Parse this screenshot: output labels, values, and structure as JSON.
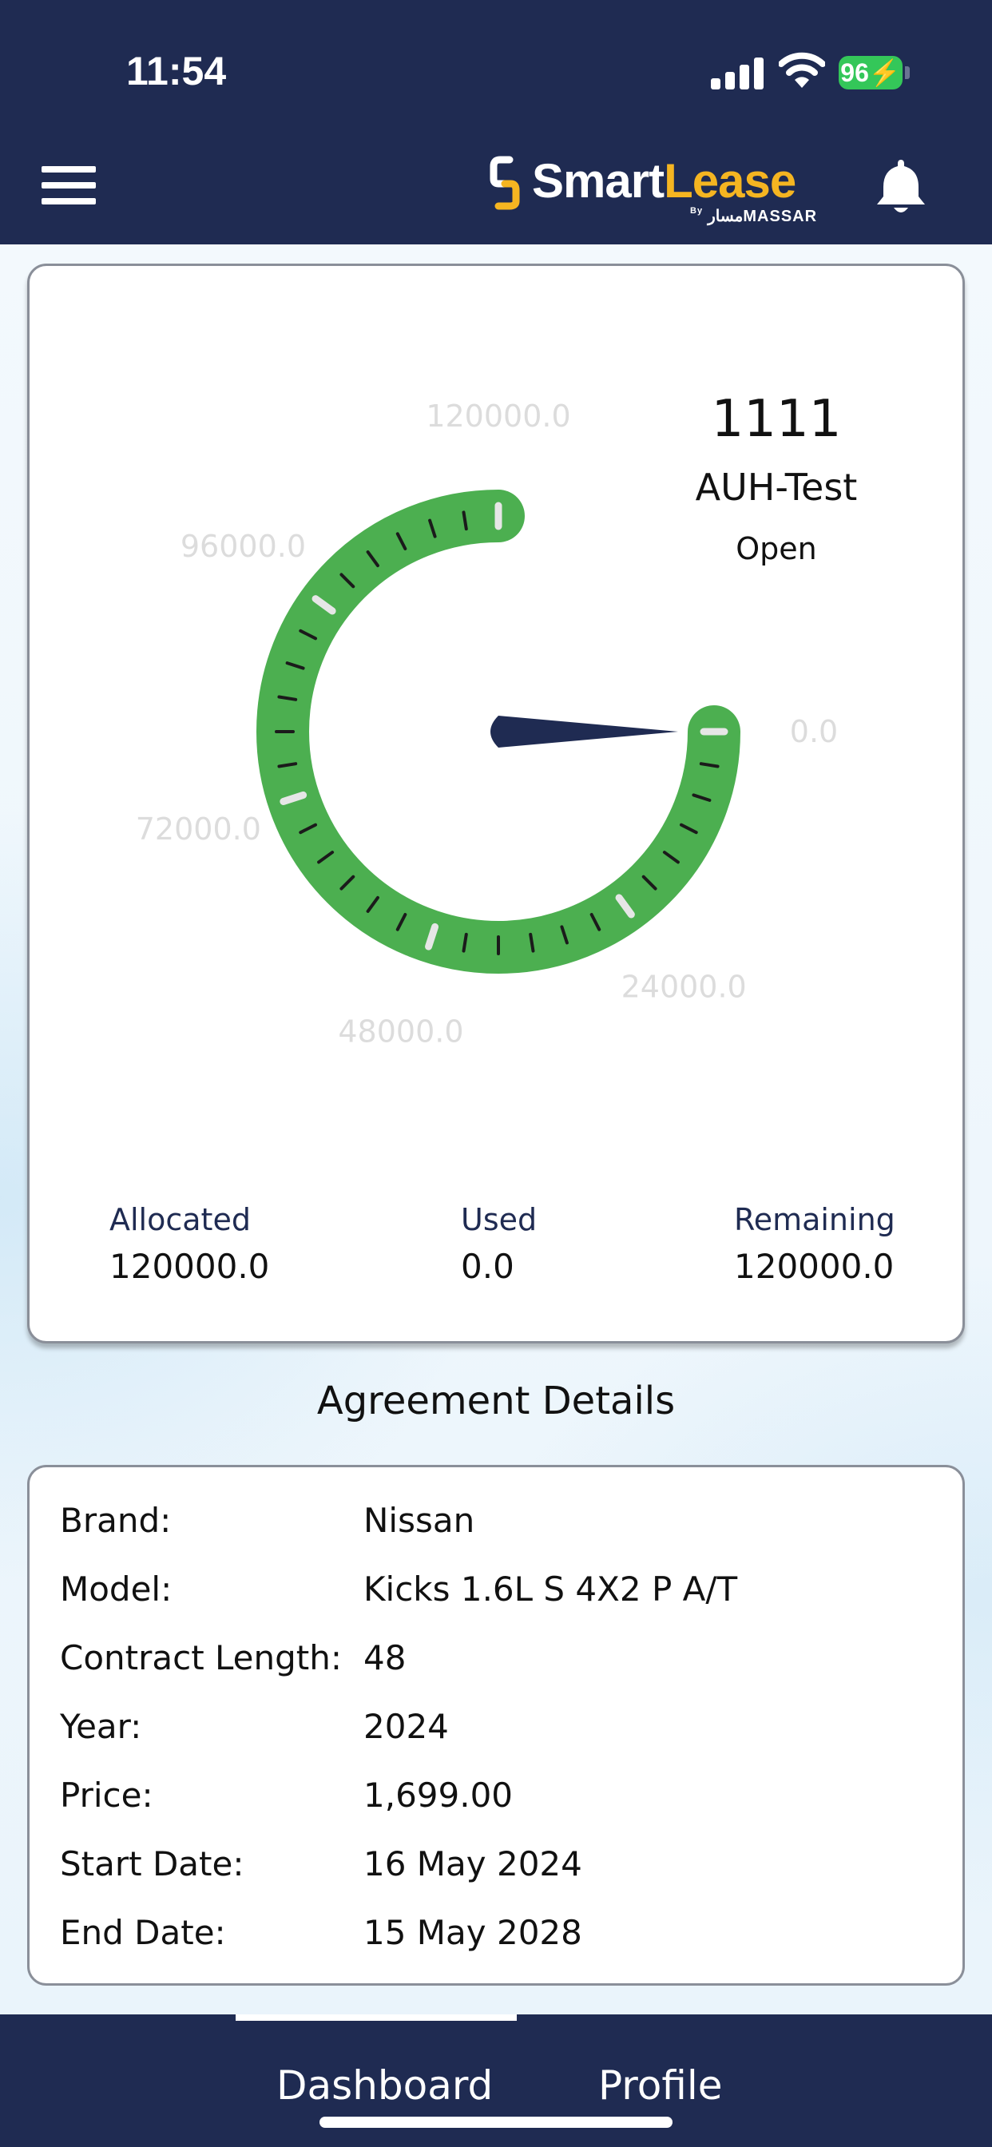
{
  "status_bar": {
    "time": "11:54",
    "battery": "96"
  },
  "header": {
    "logo": {
      "smart": "Smart",
      "lease": "Lease",
      "by": "By",
      "sub": "MASSAR",
      "sub_arabic": "مسار"
    },
    "colors": {
      "bar": "#1f2b52",
      "brand_accent": "#f5b521"
    }
  },
  "gauge": {
    "number": "1111",
    "name": "AUH-Test",
    "status": "Open",
    "min": 0,
    "max": 120000,
    "value": 0,
    "scale_labels": [
      "120000.0",
      "96000.0",
      "72000.0",
      "48000.0",
      "24000.0",
      "0.0"
    ],
    "arc_color": "#4caf50",
    "needle_color": "#1f2b52",
    "stats": {
      "allocated_label": "Allocated",
      "allocated_value": "120000.0",
      "used_label": "Used",
      "used_value": "0.0",
      "remaining_label": "Remaining",
      "remaining_value": "120000.0"
    }
  },
  "agreement": {
    "title": "Agreement Details",
    "rows": [
      {
        "key": "Brand:",
        "value": "Nissan"
      },
      {
        "key": "Model:",
        "value": "Kicks 1.6L S 4X2 P A/T"
      },
      {
        "key": "Contract Length:",
        "value": "48"
      },
      {
        "key": "Year:",
        "value": "2024"
      },
      {
        "key": "Price:",
        "value": "1,699.00"
      },
      {
        "key": "Start Date:",
        "value": "16 May 2024"
      },
      {
        "key": "End Date:",
        "value": "15 May 2028"
      }
    ]
  },
  "bottom_nav": {
    "tabs": [
      {
        "label": "Dashboard",
        "active": true
      },
      {
        "label": "Profile",
        "active": false
      }
    ]
  },
  "icons": [
    "hamburger-menu-icon",
    "bell-icon",
    "signal-icon",
    "wifi-icon",
    "battery-icon",
    "smartlease-logo-icon"
  ]
}
